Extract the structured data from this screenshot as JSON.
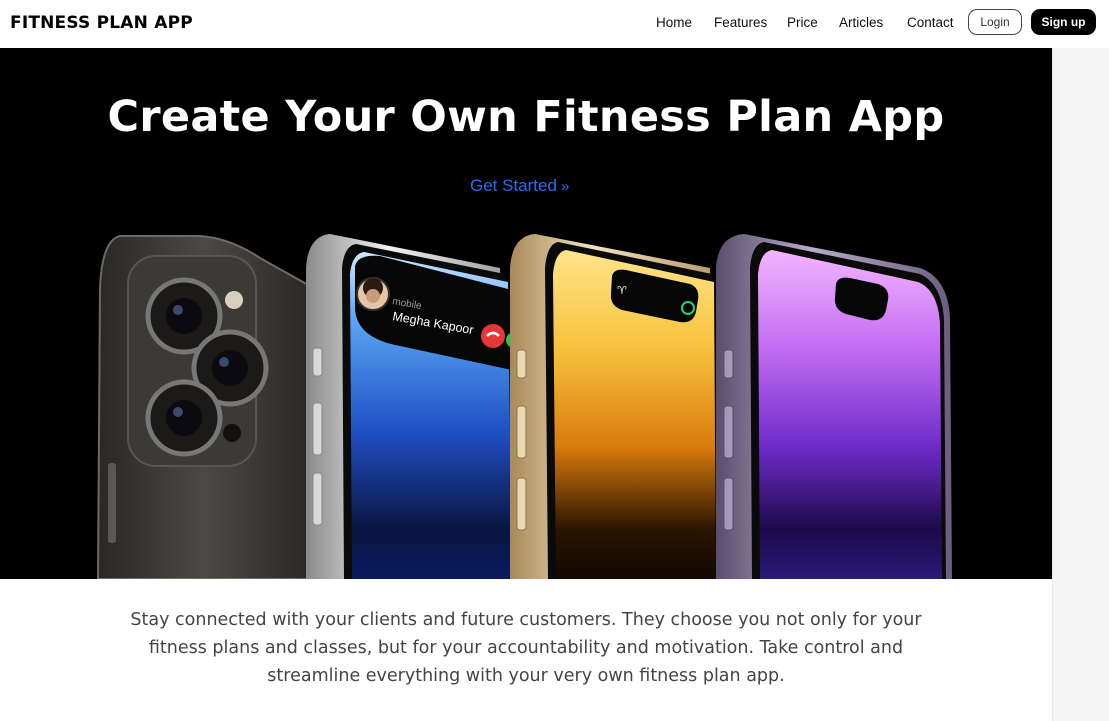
{
  "nav": {
    "brand": "FITNESS PLAN APP",
    "links": [
      "Home",
      "Features",
      "Price",
      "Articles",
      "Contact"
    ],
    "login_label": "Login",
    "signup_label": "Sign up"
  },
  "hero": {
    "title": "Create Your Own Fitness Plan App",
    "cta_label": "Get Started",
    "cta_icon": "double-chevron-right-icon",
    "call_overlay": {
      "caller_type": "mobile",
      "caller_name": "Megha Kapoor"
    }
  },
  "description": "Stay connected with your clients and future customers. They choose you not only for your fitness plans and classes, but for your accountability and motivation. Take control and streamline everything with your very own fitness plan app.",
  "colors": {
    "cta": "#2a6df0",
    "hero_bg": "#000000",
    "signup_bg": "#000000"
  }
}
